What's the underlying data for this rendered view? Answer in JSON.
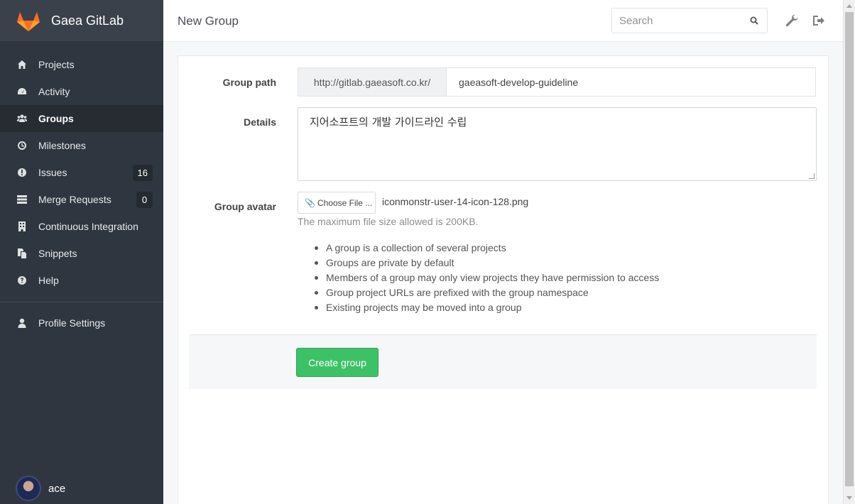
{
  "app": {
    "brand": "Gaea GitLab"
  },
  "header": {
    "title": "New Group",
    "search_placeholder": "Search"
  },
  "sidebar": {
    "items": [
      {
        "label": "Projects",
        "icon": "home-icon"
      },
      {
        "label": "Activity",
        "icon": "dashboard-icon"
      },
      {
        "label": "Groups",
        "icon": "users-icon",
        "active": true
      },
      {
        "label": "Milestones",
        "icon": "clock-icon"
      },
      {
        "label": "Issues",
        "icon": "exclamation-circle-icon",
        "badge": "16"
      },
      {
        "label": "Merge Requests",
        "icon": "list-icon",
        "badge": "0"
      },
      {
        "label": "Continuous Integration",
        "icon": "building-icon"
      },
      {
        "label": "Snippets",
        "icon": "copy-icon"
      },
      {
        "label": "Help",
        "icon": "question-circle-icon"
      }
    ],
    "profile_settings": "Profile Settings",
    "user": {
      "name": "ace"
    }
  },
  "form": {
    "group_path_label": "Group path",
    "group_path_prefix": "http://gitlab.gaeasoft.co.kr/",
    "group_path_value": "gaeasoft-develop-guideline",
    "details_label": "Details",
    "details_value": "지어소프트의 개발 가이드라인 수립",
    "avatar_label": "Group avatar",
    "choose_file_label": "Choose File ...",
    "file_name": "iconmonstr-user-14-icon-128.png",
    "file_hint": "The maximum file size allowed is 200KB.",
    "bullets": [
      "A group is a collection of several projects",
      "Groups are private by default",
      "Members of a group may only view projects they have permission to access",
      "Group project URLs are prefixed with the group namespace",
      "Existing projects may be moved into a group"
    ],
    "submit_label": "Create group"
  },
  "colors": {
    "sidebar_bg": "#2f3640",
    "brand_bg": "#3a414b",
    "create_button": "#3cc167",
    "logo_orange": "#e24329"
  }
}
